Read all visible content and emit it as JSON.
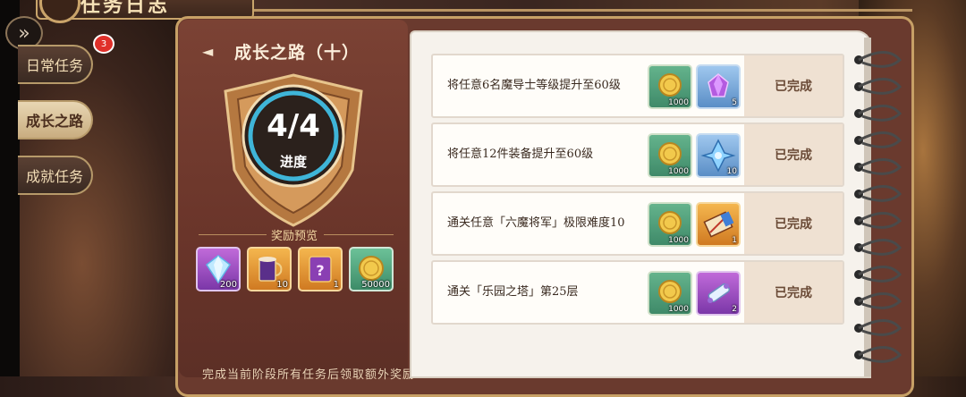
{
  "header": {
    "title": "任务日志"
  },
  "sidebar": {
    "tabs": [
      {
        "label": "日常任务",
        "badge": "3"
      },
      {
        "label": "成长之路",
        "active": true
      },
      {
        "label": "成就任务"
      }
    ]
  },
  "stage": {
    "title": "成长之路（十）",
    "progress": "4/4",
    "progress_label": "进度",
    "rewards_title": "奖励预览",
    "rewards": [
      {
        "icon": "diamond-icon",
        "count": "200"
      },
      {
        "icon": "mug-icon",
        "count": "10"
      },
      {
        "icon": "mystery-ticket-icon",
        "count": "1"
      },
      {
        "icon": "gold-coin-icon",
        "count": "50000"
      }
    ],
    "footer_text": "完成当前阶段所有任务后领取额外奖励"
  },
  "tasks": [
    {
      "desc": "将任意6名魔导士等级提升至60级",
      "items": [
        {
          "icon": "gold-coin-icon",
          "count": "1000"
        },
        {
          "icon": "purple-gem-icon",
          "count": "5"
        }
      ],
      "status": "已完成"
    },
    {
      "desc": "将任意12件装备提升至60级",
      "items": [
        {
          "icon": "gold-coin-icon",
          "count": "1000"
        },
        {
          "icon": "blue-crystal-icon",
          "count": "10"
        }
      ],
      "status": "已完成"
    },
    {
      "desc": "通关任意「六魔将军」极限难度10",
      "items": [
        {
          "icon": "gold-coin-icon",
          "count": "1000"
        },
        {
          "icon": "blueprint-icon",
          "count": "1"
        }
      ],
      "status": "已完成"
    },
    {
      "desc": "通关「乐园之塔」第25层",
      "items": [
        {
          "icon": "gold-coin-icon",
          "count": "1000"
        },
        {
          "icon": "scroll-icon",
          "count": "2"
        }
      ],
      "status": "已完成"
    }
  ]
}
